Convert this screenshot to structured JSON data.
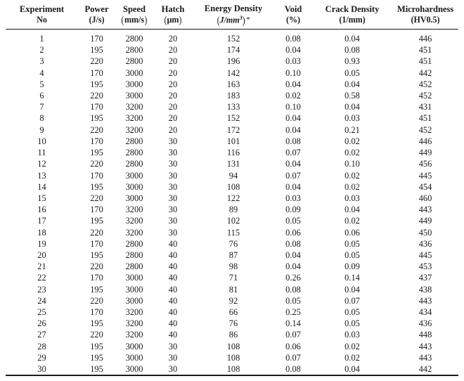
{
  "table": {
    "columns": [
      {
        "id": "experiment_no",
        "line1": "Experiment",
        "line2": "No"
      },
      {
        "id": "power",
        "line1": "Power",
        "line2": "(J/s)"
      },
      {
        "id": "speed",
        "line1": "Speed",
        "line2": "(mm/s)"
      },
      {
        "id": "hatch",
        "line1": "Hatch",
        "line2": "(µm)"
      },
      {
        "id": "energy_density",
        "line1": "Energy Density",
        "line2": "(J/mm3) *"
      },
      {
        "id": "void",
        "line1": "Void",
        "line2": "(%)"
      },
      {
        "id": "crack_density",
        "line1": "Crack Density",
        "line2": "(1/mm)"
      },
      {
        "id": "microhardness",
        "line1": "Microhardness",
        "line2": "(HV0.5)"
      }
    ],
    "rows": [
      [
        "1",
        "170",
        "2800",
        "20",
        "152",
        "0.08",
        "0.04",
        "446"
      ],
      [
        "2",
        "195",
        "2800",
        "20",
        "174",
        "0.04",
        "0.08",
        "451"
      ],
      [
        "3",
        "220",
        "2800",
        "20",
        "196",
        "0.03",
        "0.93",
        "451"
      ],
      [
        "4",
        "170",
        "3000",
        "20",
        "142",
        "0.10",
        "0.05",
        "442"
      ],
      [
        "5",
        "195",
        "3000",
        "20",
        "163",
        "0.04",
        "0.04",
        "452"
      ],
      [
        "6",
        "220",
        "3000",
        "20",
        "183",
        "0.02",
        "0.58",
        "452"
      ],
      [
        "7",
        "170",
        "3200",
        "20",
        "133",
        "0.10",
        "0.04",
        "431"
      ],
      [
        "8",
        "195",
        "3200",
        "20",
        "152",
        "0.04",
        "0.03",
        "451"
      ],
      [
        "9",
        "220",
        "3200",
        "20",
        "172",
        "0.04",
        "0.21",
        "452"
      ],
      [
        "10",
        "170",
        "2800",
        "30",
        "101",
        "0.08",
        "0.02",
        "446"
      ],
      [
        "11",
        "195",
        "2800",
        "30",
        "116",
        "0.07",
        "0.02",
        "449"
      ],
      [
        "12",
        "220",
        "2800",
        "30",
        "131",
        "0.04",
        "0.10",
        "456"
      ],
      [
        "13",
        "170",
        "3000",
        "30",
        "94",
        "0.07",
        "0.02",
        "445"
      ],
      [
        "14",
        "195",
        "3000",
        "30",
        "108",
        "0.04",
        "0.02",
        "454"
      ],
      [
        "15",
        "220",
        "3000",
        "30",
        "122",
        "0.03",
        "0.03",
        "460"
      ],
      [
        "16",
        "170",
        "3200",
        "30",
        "89",
        "0.09",
        "0.04",
        "443"
      ],
      [
        "17",
        "195",
        "3200",
        "30",
        "102",
        "0.05",
        "0.02",
        "449"
      ],
      [
        "18",
        "220",
        "3200",
        "30",
        "115",
        "0.06",
        "0.06",
        "450"
      ],
      [
        "19",
        "170",
        "2800",
        "40",
        "76",
        "0.08",
        "0.05",
        "436"
      ],
      [
        "20",
        "195",
        "2800",
        "40",
        "87",
        "0.04",
        "0.05",
        "445"
      ],
      [
        "21",
        "220",
        "2800",
        "40",
        "98",
        "0.04",
        "0.09",
        "453"
      ],
      [
        "22",
        "170",
        "3000",
        "40",
        "71",
        "0.26",
        "0.14",
        "437"
      ],
      [
        "23",
        "195",
        "3000",
        "40",
        "81",
        "0.08",
        "0.04",
        "438"
      ],
      [
        "24",
        "220",
        "3000",
        "40",
        "92",
        "0.05",
        "0.07",
        "443"
      ],
      [
        "25",
        "170",
        "3200",
        "40",
        "66",
        "0.25",
        "0.05",
        "434"
      ],
      [
        "26",
        "195",
        "3200",
        "40",
        "76",
        "0.14",
        "0.05",
        "436"
      ],
      [
        "27",
        "220",
        "3200",
        "40",
        "86",
        "0.07",
        "0.03",
        "448"
      ],
      [
        "28",
        "195",
        "3000",
        "30",
        "108",
        "0.06",
        "0.02",
        "443"
      ],
      [
        "29",
        "195",
        "3000",
        "30",
        "108",
        "0.07",
        "0.02",
        "443"
      ],
      [
        "30",
        "195",
        "3000",
        "30",
        "108",
        "0.08",
        "0.04",
        "442"
      ]
    ]
  },
  "style": {
    "rule_color": "#1a1a1a",
    "text_color": "#1a1a1a",
    "background": "#ffffff"
  }
}
